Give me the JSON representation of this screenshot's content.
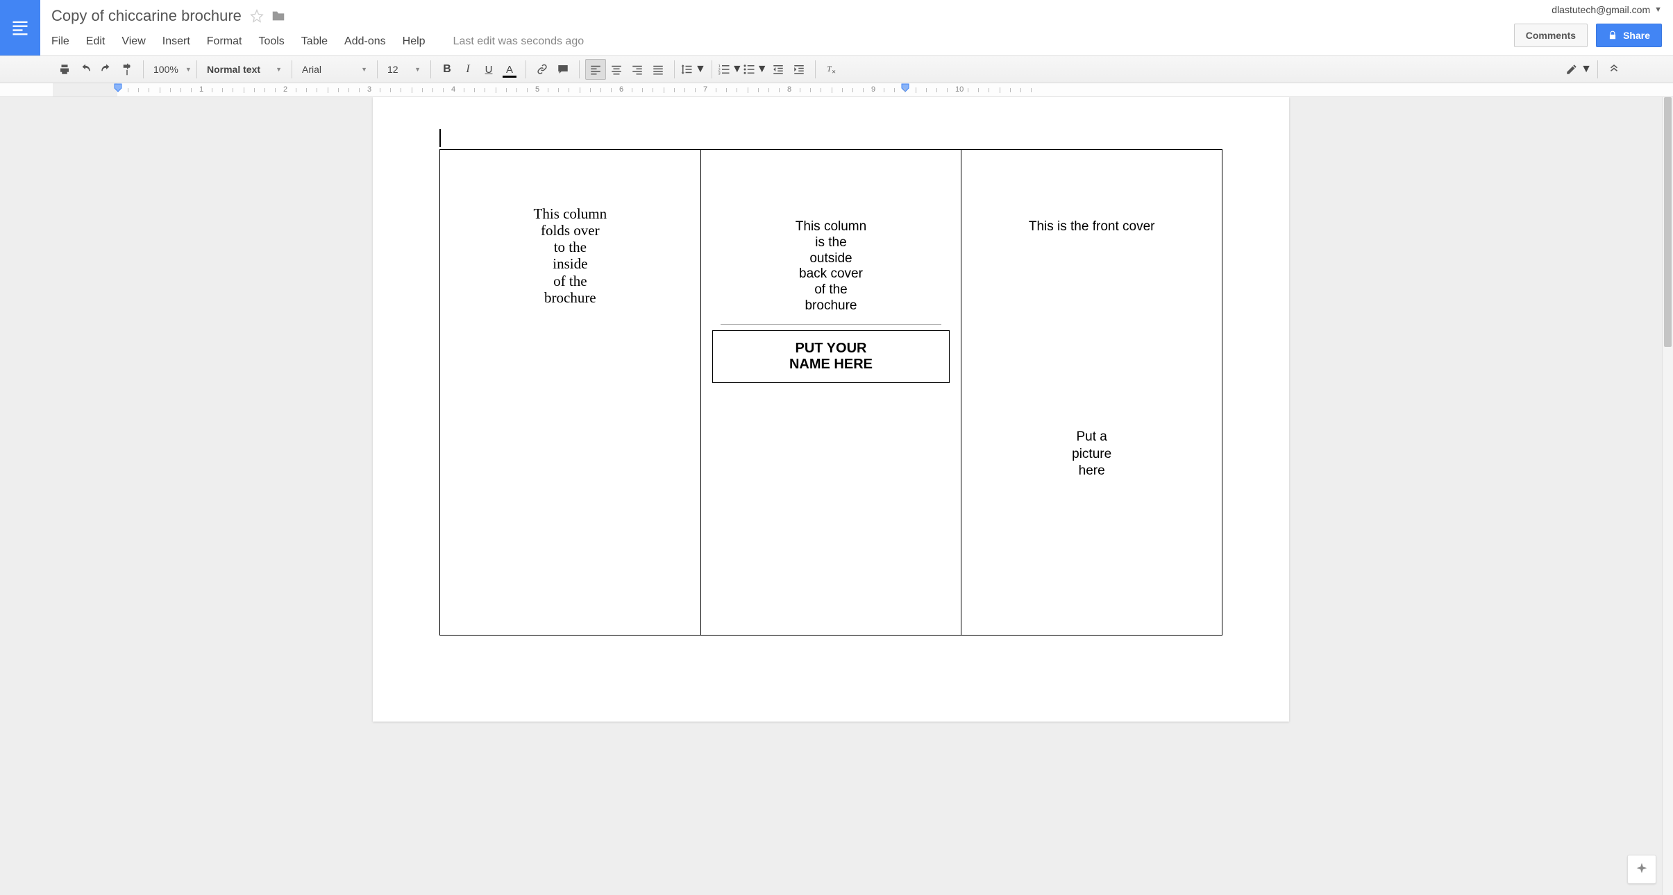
{
  "header": {
    "doc_title": "Copy of chiccarine brochure",
    "account_email": "dlastutech@gmail.com",
    "comments_label": "Comments",
    "share_label": "Share"
  },
  "menu": {
    "items": [
      "File",
      "Edit",
      "View",
      "Insert",
      "Format",
      "Tools",
      "Table",
      "Add-ons",
      "Help"
    ],
    "last_edit": "Last edit was seconds ago"
  },
  "toolbar": {
    "zoom": "100%",
    "style": "Normal text",
    "font": "Arial",
    "size": "12"
  },
  "ruler": {
    "numbers": [
      "1",
      "2",
      "3",
      "4",
      "5",
      "6",
      "7",
      "8",
      "9",
      "10"
    ]
  },
  "document": {
    "col1": [
      "This column",
      "folds over",
      "to the",
      "inside",
      "of the",
      "brochure"
    ],
    "col2": [
      "This column",
      "is the",
      "outside",
      "back cover",
      "of the",
      "brochure"
    ],
    "col2_box": [
      "PUT YOUR",
      "NAME HERE"
    ],
    "col3_heading": "This is the front cover",
    "col3_picture": [
      "Put a",
      "picture",
      "here"
    ]
  }
}
